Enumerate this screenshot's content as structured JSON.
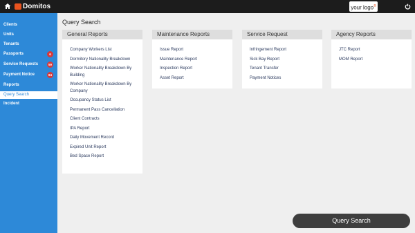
{
  "app": {
    "title": "Domitos",
    "client_logo_text": "your logo",
    "client_logo_mark": "®"
  },
  "icons": {
    "home": "home-icon",
    "power": "power-icon",
    "brand": "domitos-logo-icon"
  },
  "colors": {
    "sidebar": "#2d89d8",
    "topbar": "#1c1c1c",
    "badge": "#d93838",
    "link": "#2b3a5e",
    "button": "#3e3e3e"
  },
  "sidebar": {
    "items": [
      {
        "label": "Clients"
      },
      {
        "label": "Units"
      },
      {
        "label": "Tenants"
      },
      {
        "label": "Passports",
        "badge": "6"
      },
      {
        "label": "Service Requests",
        "badge": "59"
      },
      {
        "label": "Payment Notice",
        "badge": "84"
      },
      {
        "label": "Reports"
      },
      {
        "label": "Query Search",
        "active": true
      },
      {
        "label": "Incident"
      }
    ]
  },
  "main": {
    "title": "Query Search",
    "cards": [
      {
        "title": "General Reports",
        "links": [
          "Company Workers List",
          "Dormitory Nationality Breakdown",
          "Worker Nationality Breakdown By Building",
          "Worker Nationality Breakdown By Company",
          "Occupancy Status List",
          "Permanent Pass Cancellation",
          "Client Contracts",
          "IPA Report",
          "Daily Movement Record",
          "Expired Unit Report",
          "Bed Space Report"
        ]
      },
      {
        "title": "Maintenance Reports",
        "links": [
          "Issue Report",
          "Maintenance Report",
          "Inspection Report",
          "Asset Report"
        ]
      },
      {
        "title": "Service Request",
        "links": [
          "Infringement Report",
          "Sick Bay Report",
          "Tenant Transfer",
          "Payment Notices"
        ]
      },
      {
        "title": "Agency Reports",
        "links": [
          "JTC Report",
          "MOM Report"
        ]
      }
    ],
    "query_button": "Query Search"
  }
}
